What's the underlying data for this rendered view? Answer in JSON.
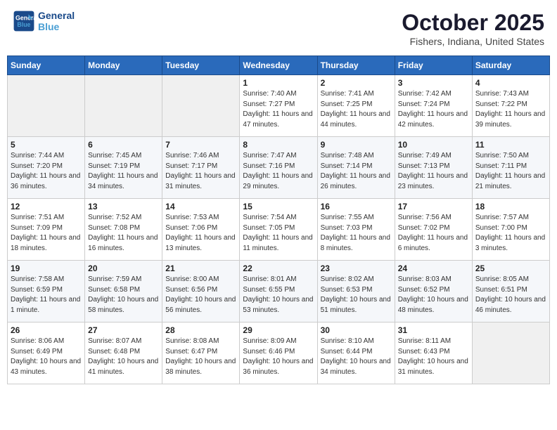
{
  "header": {
    "logo_line1": "General",
    "logo_line2": "Blue",
    "month": "October 2025",
    "location": "Fishers, Indiana, United States"
  },
  "weekdays": [
    "Sunday",
    "Monday",
    "Tuesday",
    "Wednesday",
    "Thursday",
    "Friday",
    "Saturday"
  ],
  "weeks": [
    [
      {
        "day": "",
        "info": ""
      },
      {
        "day": "",
        "info": ""
      },
      {
        "day": "",
        "info": ""
      },
      {
        "day": "1",
        "info": "Sunrise: 7:40 AM\nSunset: 7:27 PM\nDaylight: 11 hours and 47 minutes."
      },
      {
        "day": "2",
        "info": "Sunrise: 7:41 AM\nSunset: 7:25 PM\nDaylight: 11 hours and 44 minutes."
      },
      {
        "day": "3",
        "info": "Sunrise: 7:42 AM\nSunset: 7:24 PM\nDaylight: 11 hours and 42 minutes."
      },
      {
        "day": "4",
        "info": "Sunrise: 7:43 AM\nSunset: 7:22 PM\nDaylight: 11 hours and 39 minutes."
      }
    ],
    [
      {
        "day": "5",
        "info": "Sunrise: 7:44 AM\nSunset: 7:20 PM\nDaylight: 11 hours and 36 minutes."
      },
      {
        "day": "6",
        "info": "Sunrise: 7:45 AM\nSunset: 7:19 PM\nDaylight: 11 hours and 34 minutes."
      },
      {
        "day": "7",
        "info": "Sunrise: 7:46 AM\nSunset: 7:17 PM\nDaylight: 11 hours and 31 minutes."
      },
      {
        "day": "8",
        "info": "Sunrise: 7:47 AM\nSunset: 7:16 PM\nDaylight: 11 hours and 29 minutes."
      },
      {
        "day": "9",
        "info": "Sunrise: 7:48 AM\nSunset: 7:14 PM\nDaylight: 11 hours and 26 minutes."
      },
      {
        "day": "10",
        "info": "Sunrise: 7:49 AM\nSunset: 7:13 PM\nDaylight: 11 hours and 23 minutes."
      },
      {
        "day": "11",
        "info": "Sunrise: 7:50 AM\nSunset: 7:11 PM\nDaylight: 11 hours and 21 minutes."
      }
    ],
    [
      {
        "day": "12",
        "info": "Sunrise: 7:51 AM\nSunset: 7:09 PM\nDaylight: 11 hours and 18 minutes."
      },
      {
        "day": "13",
        "info": "Sunrise: 7:52 AM\nSunset: 7:08 PM\nDaylight: 11 hours and 16 minutes."
      },
      {
        "day": "14",
        "info": "Sunrise: 7:53 AM\nSunset: 7:06 PM\nDaylight: 11 hours and 13 minutes."
      },
      {
        "day": "15",
        "info": "Sunrise: 7:54 AM\nSunset: 7:05 PM\nDaylight: 11 hours and 11 minutes."
      },
      {
        "day": "16",
        "info": "Sunrise: 7:55 AM\nSunset: 7:03 PM\nDaylight: 11 hours and 8 minutes."
      },
      {
        "day": "17",
        "info": "Sunrise: 7:56 AM\nSunset: 7:02 PM\nDaylight: 11 hours and 6 minutes."
      },
      {
        "day": "18",
        "info": "Sunrise: 7:57 AM\nSunset: 7:00 PM\nDaylight: 11 hours and 3 minutes."
      }
    ],
    [
      {
        "day": "19",
        "info": "Sunrise: 7:58 AM\nSunset: 6:59 PM\nDaylight: 11 hours and 1 minute."
      },
      {
        "day": "20",
        "info": "Sunrise: 7:59 AM\nSunset: 6:58 PM\nDaylight: 10 hours and 58 minutes."
      },
      {
        "day": "21",
        "info": "Sunrise: 8:00 AM\nSunset: 6:56 PM\nDaylight: 10 hours and 56 minutes."
      },
      {
        "day": "22",
        "info": "Sunrise: 8:01 AM\nSunset: 6:55 PM\nDaylight: 10 hours and 53 minutes."
      },
      {
        "day": "23",
        "info": "Sunrise: 8:02 AM\nSunset: 6:53 PM\nDaylight: 10 hours and 51 minutes."
      },
      {
        "day": "24",
        "info": "Sunrise: 8:03 AM\nSunset: 6:52 PM\nDaylight: 10 hours and 48 minutes."
      },
      {
        "day": "25",
        "info": "Sunrise: 8:05 AM\nSunset: 6:51 PM\nDaylight: 10 hours and 46 minutes."
      }
    ],
    [
      {
        "day": "26",
        "info": "Sunrise: 8:06 AM\nSunset: 6:49 PM\nDaylight: 10 hours and 43 minutes."
      },
      {
        "day": "27",
        "info": "Sunrise: 8:07 AM\nSunset: 6:48 PM\nDaylight: 10 hours and 41 minutes."
      },
      {
        "day": "28",
        "info": "Sunrise: 8:08 AM\nSunset: 6:47 PM\nDaylight: 10 hours and 38 minutes."
      },
      {
        "day": "29",
        "info": "Sunrise: 8:09 AM\nSunset: 6:46 PM\nDaylight: 10 hours and 36 minutes."
      },
      {
        "day": "30",
        "info": "Sunrise: 8:10 AM\nSunset: 6:44 PM\nDaylight: 10 hours and 34 minutes."
      },
      {
        "day": "31",
        "info": "Sunrise: 8:11 AM\nSunset: 6:43 PM\nDaylight: 10 hours and 31 minutes."
      },
      {
        "day": "",
        "info": ""
      }
    ]
  ]
}
